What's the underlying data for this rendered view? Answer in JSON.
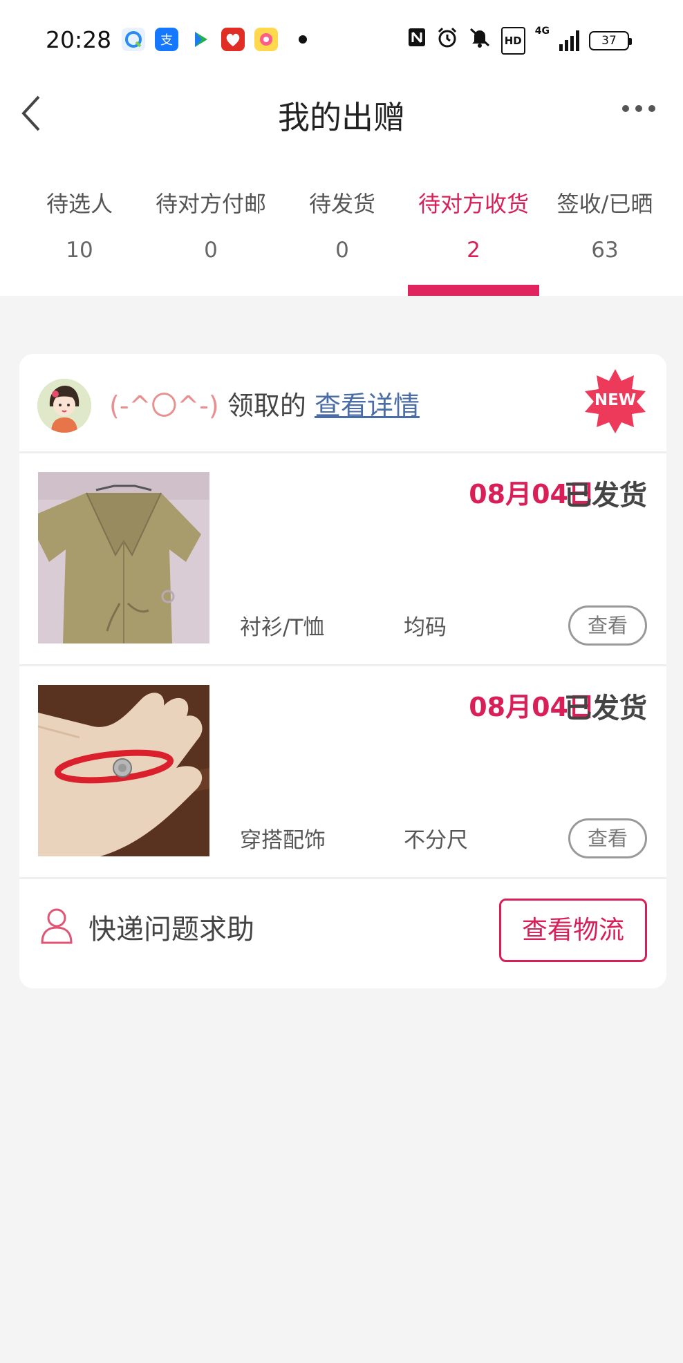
{
  "status_bar": {
    "time": "20:28",
    "network": "4G",
    "hd": "HD",
    "battery": "37",
    "icons": [
      "browser-icon",
      "alipay-icon",
      "video-app-icon",
      "pinduoduo-icon",
      "meitu-icon",
      "nfc-icon",
      "alarm-icon",
      "mute-icon",
      "hd-icon",
      "signal-icon",
      "battery-icon"
    ]
  },
  "nav": {
    "title": "我的出赠"
  },
  "tabs": [
    {
      "label": "待选人",
      "count": "10"
    },
    {
      "label": "待对方付邮",
      "count": "0"
    },
    {
      "label": "待发货",
      "count": "0"
    },
    {
      "label": "待对方收货",
      "count": "2"
    },
    {
      "label": "签收/已晒",
      "count": "63"
    }
  ],
  "active_tab": 3,
  "colors": {
    "accent": "#e0245e",
    "link": "#4a6da7",
    "receiver": "#e88f8f"
  },
  "card": {
    "receiver": "(-^〇^-)",
    "receive_text": " 领取的 ",
    "detail_link": "查看详情",
    "badge": "NEW",
    "items": [
      {
        "date": "08月04日",
        "status": "已发货",
        "category": "衬衫/T恤",
        "size": "均码",
        "view_label": "查看"
      },
      {
        "date": "08月04日",
        "status": "已发货",
        "category": "穿搭配饰",
        "size": "不分尺",
        "view_label": "查看"
      }
    ],
    "footer": {
      "help_text": "快递问题求助",
      "logistics_label": "查看物流"
    }
  }
}
